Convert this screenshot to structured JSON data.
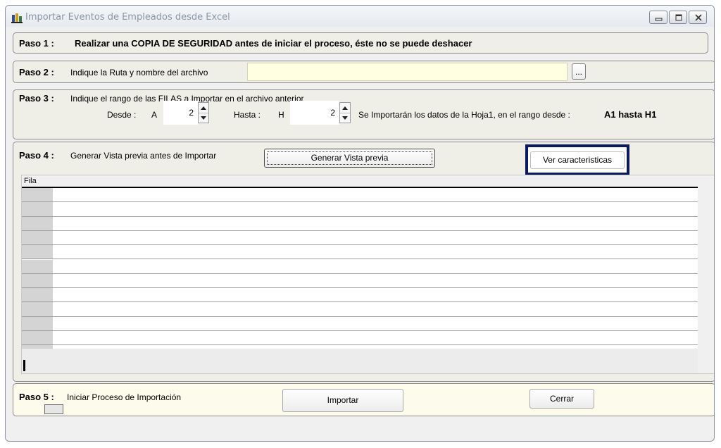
{
  "window": {
    "title": "Importar Eventos de Empleados desde Excel"
  },
  "step1": {
    "label": "Paso 1 :",
    "text": "Realizar una COPIA DE SEGURIDAD antes de iniciar el proceso, éste no se puede deshacer"
  },
  "step2": {
    "label": "Paso 2 :",
    "text": "Indique la Ruta y nombre del archivo",
    "path_value": "",
    "browse_label": "..."
  },
  "step3": {
    "label": "Paso 3 :",
    "text": "Indique el rango de las FILAS a Importar en el archivo anterior",
    "from_label": "Desde :",
    "from_col": "A",
    "from_value": "2",
    "to_label": "Hasta :",
    "to_col": "H",
    "to_value": "2",
    "info_text": "Se Importarán los datos de la Hoja1,  en el rango desde :",
    "range_text": "A1 hasta H1"
  },
  "step4": {
    "label": "Paso 4 :",
    "text": "Generar Vista previa antes de Importar",
    "preview_button": "Generar Vista previa",
    "features_button": "Ver caracteristicas",
    "grid_column_header": "Fila",
    "grid_rows": 12
  },
  "step5": {
    "label": "Paso 5 :",
    "text": "Iniciar Proceso de Importación",
    "import_button": "Importar",
    "close_button": "Cerrar"
  },
  "colors": {
    "panel_bg": "#efefe7",
    "input_bg": "#ffffe1",
    "focus_border": "#0a1a5e",
    "title_text": "#8c96a3"
  },
  "icons": [
    "app-icon",
    "minimize-icon",
    "maximize-icon",
    "close-icon",
    "spin-up-icon",
    "spin-down-icon"
  ]
}
